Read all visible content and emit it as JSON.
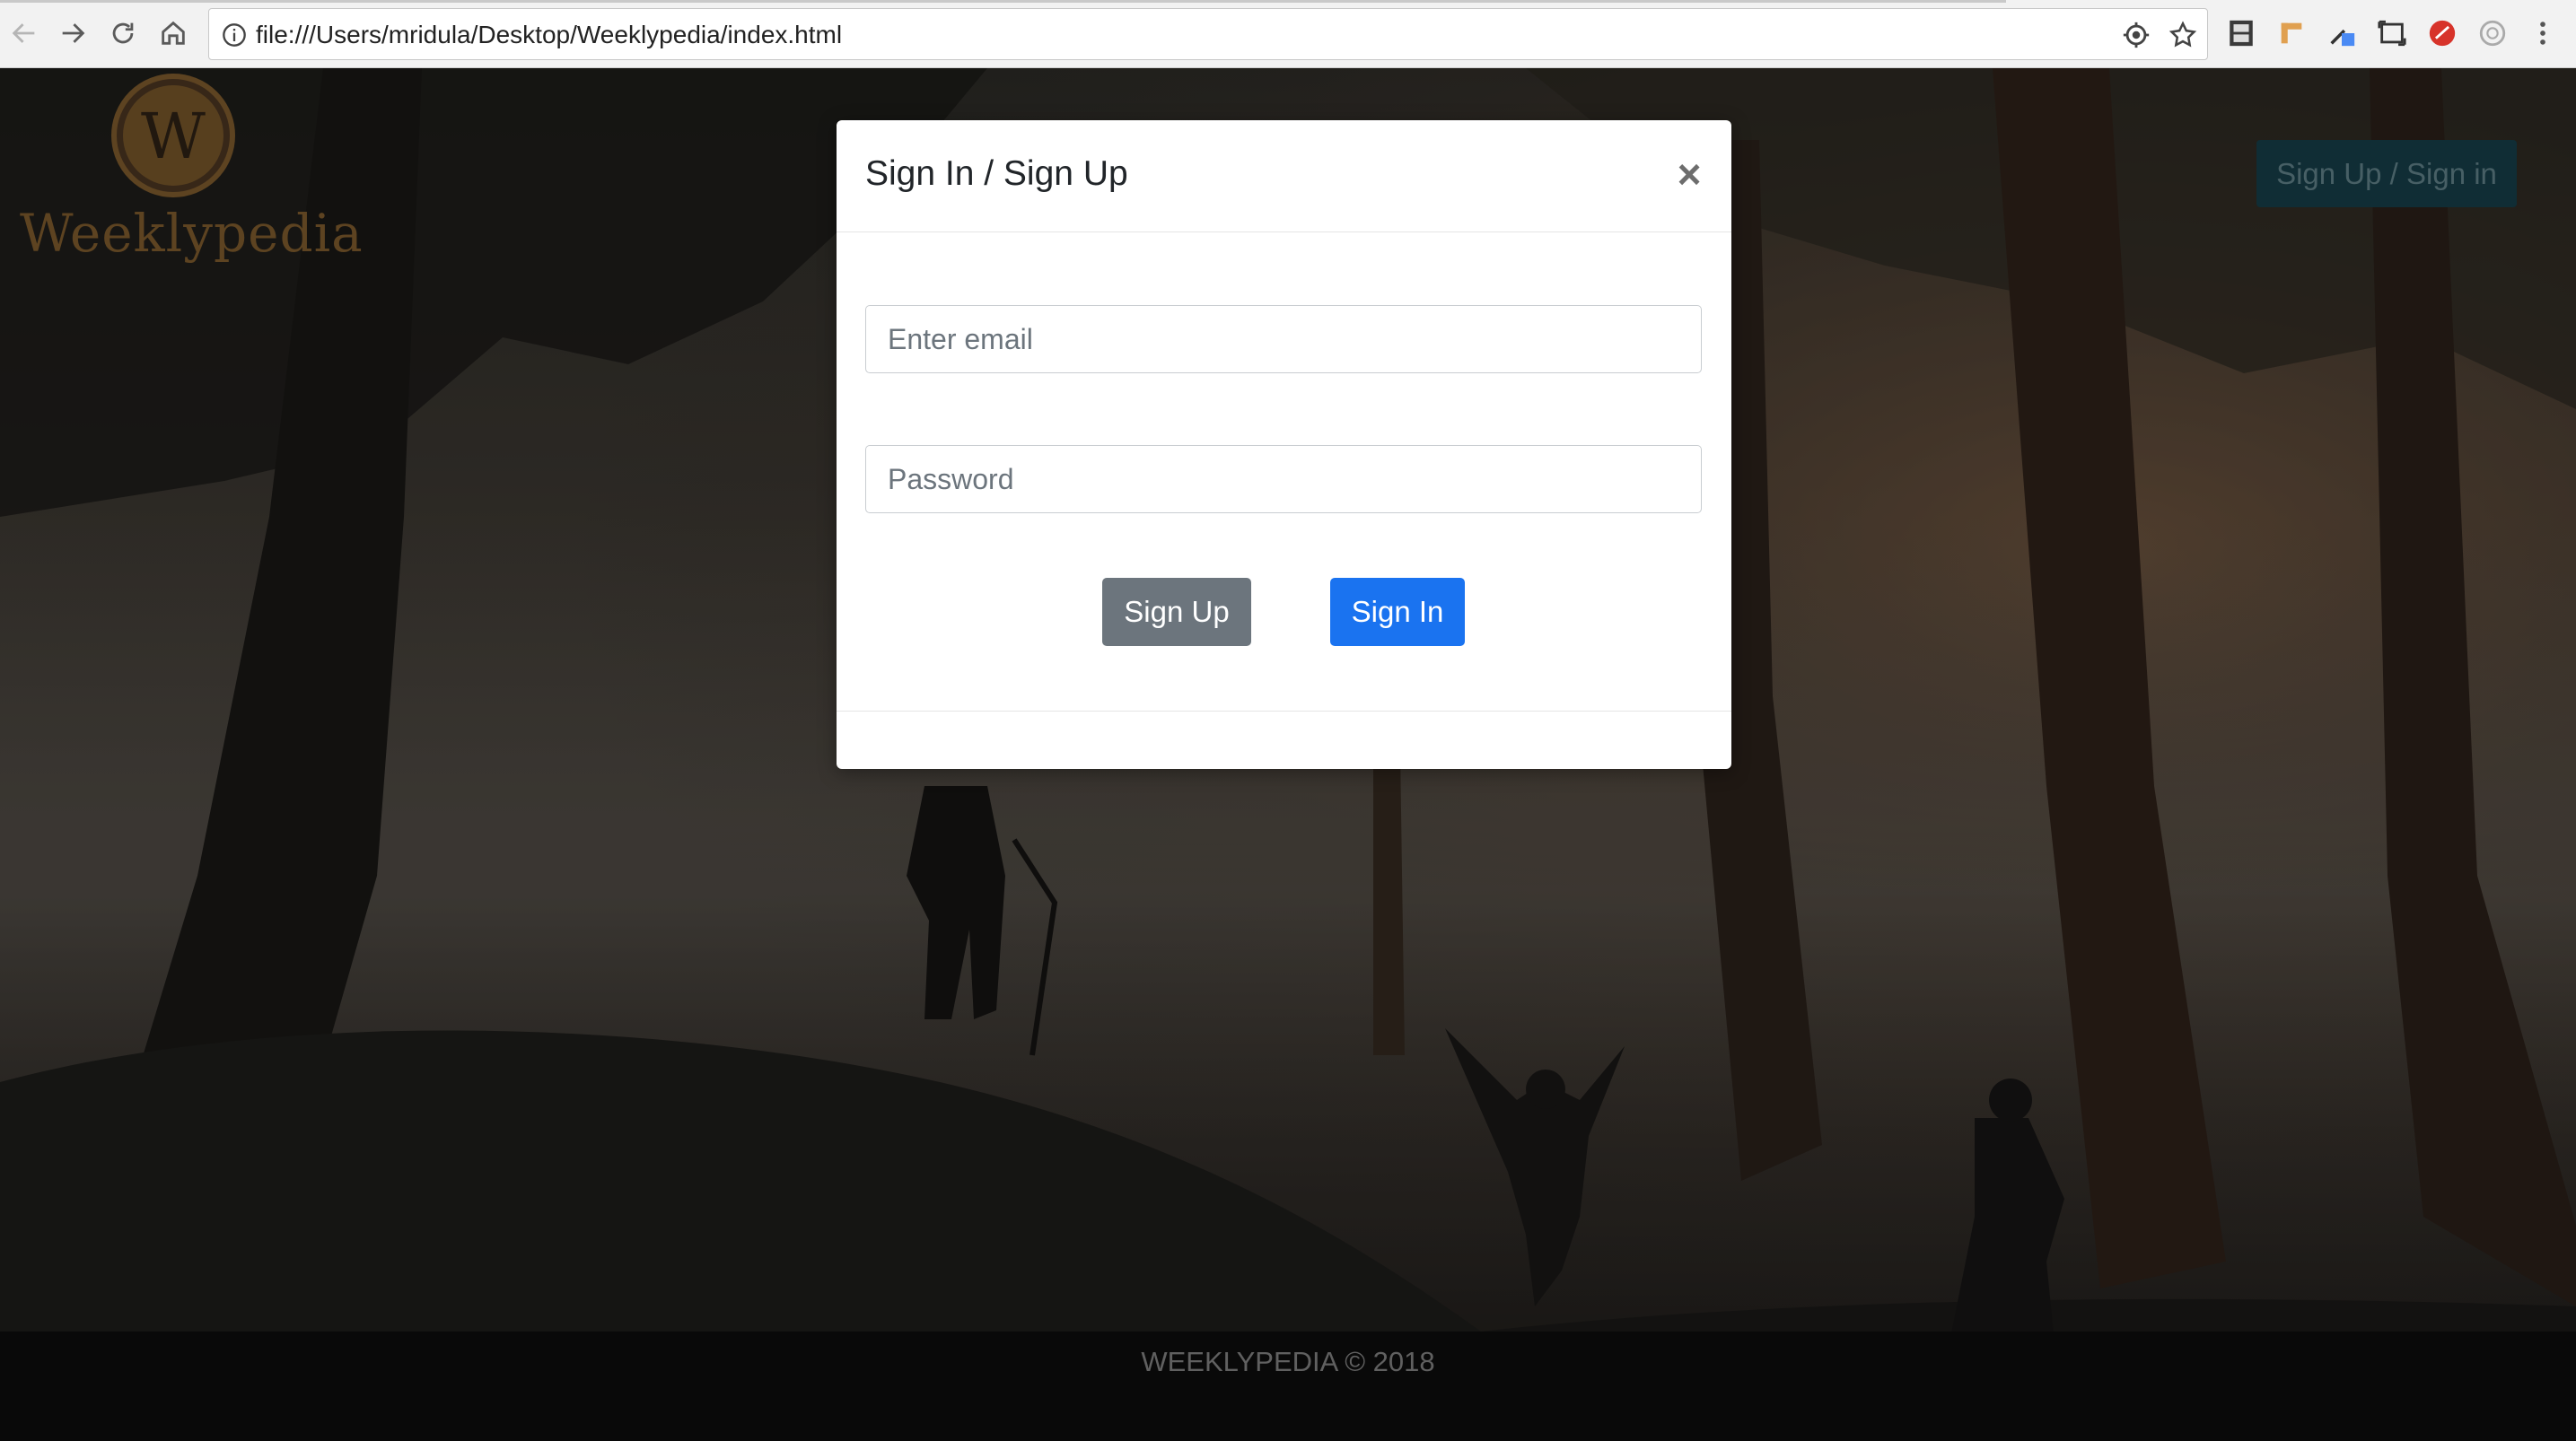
{
  "browser": {
    "url": "file:///Users/mridula/Desktop/Weeklypedia/index.html"
  },
  "header": {
    "logo_letter": "W",
    "brand_name": "Weeklypedia",
    "signup_signin_label": "Sign Up / Sign in"
  },
  "modal": {
    "title": "Sign In / Sign Up",
    "close_label": "×",
    "email_placeholder": "Enter email",
    "password_placeholder": "Password",
    "signup_label": "Sign Up",
    "signin_label": "Sign In"
  },
  "footer": {
    "text": "WEEKLYPEDIA © 2018"
  },
  "colors": {
    "brand_gold": "#7c5a2c",
    "primary_blue": "#1a73f0",
    "secondary_gray": "#6c757d",
    "header_button_bg": "#163d47"
  }
}
